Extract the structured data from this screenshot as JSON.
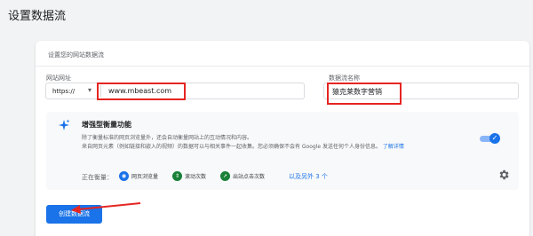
{
  "page": {
    "title": "设置数据流"
  },
  "form": {
    "section_title": "设置您的网站数据流",
    "url_label": "网站网址",
    "protocol": "https://",
    "url_value": "www.mbeast.com",
    "stream_name_label": "数据流名称",
    "stream_name_value": "猿克莱数字营销"
  },
  "enhanced_measurement": {
    "title": "增强型衡量功能",
    "desc_line1": "除了衡量标准的网页浏览量外，还会自动衡量网站上的互动情况和内容。",
    "desc_line2": "来自网页元素（例如链接和嵌入的视频）的数据可以与相关事件一起收集。您必须确保不会有 Google 发送任何个人身份信息。",
    "learn_more": "了解详情",
    "enabled": true,
    "measuring_label": "正在衡量：",
    "chips": [
      {
        "label": "网页浏览量",
        "icon": "eye-icon",
        "color": "#1a73e8"
      },
      {
        "label": "滚动次数",
        "icon": "scroll-icon",
        "color": "#188038"
      },
      {
        "label": "出站点击次数",
        "icon": "cursor-icon",
        "color": "#188038"
      }
    ],
    "more_link": "以及另外 3 个"
  },
  "actions": {
    "create_button": "创建数据流"
  },
  "colors": {
    "accent": "#1a73e8",
    "annotation_red": "#e52521"
  }
}
